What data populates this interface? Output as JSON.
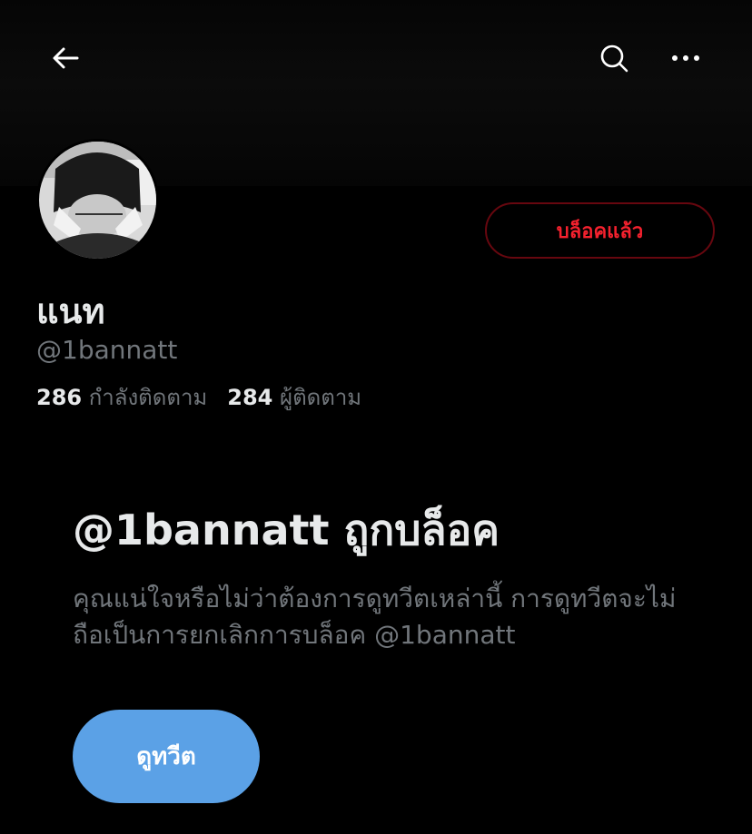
{
  "header": {
    "back_icon": "arrow-left-icon",
    "search_icon": "search-icon",
    "more_icon": "more-horizontal-icon"
  },
  "profile": {
    "display_name": "แนท",
    "handle": "@1bannatt",
    "blocked_label": "บล็อคแล้ว",
    "following_count": "286",
    "following_label": "กำลังติดตาม",
    "followers_count": "284",
    "followers_label": "ผู้ติดตาม"
  },
  "blocked_notice": {
    "title": "@1bannatt ถูกบล็อค",
    "description": "คุณแน่ใจหรือไม่ว่าต้องการดูทวีตเหล่านี้ การดูทวีตจะไม่ถือเป็นการยกเลิกการบล็อค @1bannatt",
    "view_button": "ดูทวีต"
  },
  "colors": {
    "background": "#000000",
    "blocked_red": "#f4212e",
    "accent_blue": "#5ba1e6",
    "secondary_text": "#71767b"
  }
}
